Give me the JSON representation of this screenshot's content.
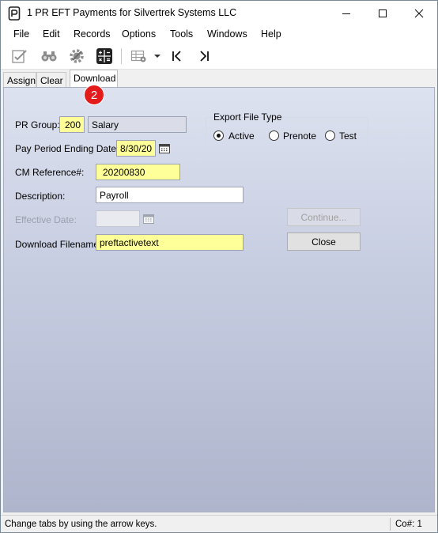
{
  "window": {
    "title": "1 PR EFT Payments for Silvertrek Systems LLC"
  },
  "menu": {
    "items": [
      "File",
      "Edit",
      "Records",
      "Options",
      "Tools",
      "Windows",
      "Help"
    ]
  },
  "toolbar": {
    "icons": [
      "approve-icon",
      "find-icon",
      "settings-icon",
      "calculator-icon",
      "grid-options-icon",
      "dropdown-arrow-icon",
      "first-record-icon",
      "last-record-icon"
    ]
  },
  "tabs": {
    "items": [
      "Assign",
      "Clear",
      "Download"
    ],
    "active": "Download"
  },
  "step_badge": "2",
  "form": {
    "pr_group_label": "PR Group:",
    "pr_group_value": "200",
    "pr_group_name": "Salary",
    "pay_period_label": "Pay Period Ending Date:",
    "pay_period_value": "8/30/20",
    "cm_reference_label": "CM Reference#:",
    "cm_reference_value": "20200830",
    "description_label": "Description:",
    "description_value": "Payroll",
    "effective_date_label": "Effective Date:",
    "effective_date_value": "",
    "download_filename_label": "Download Filename:",
    "download_filename_value": "preftactivetext"
  },
  "export": {
    "title": "Export File Type",
    "options": [
      "Active",
      "Prenote",
      "Test"
    ],
    "selected": "Active"
  },
  "buttons": {
    "continue_label": "Continue...",
    "close_label": "Close"
  },
  "status": {
    "message": "Change tabs by using the arrow keys.",
    "company": "Co#: 1"
  },
  "colors": {
    "required_field": "#ffff99",
    "badge": "#e31b1b"
  }
}
